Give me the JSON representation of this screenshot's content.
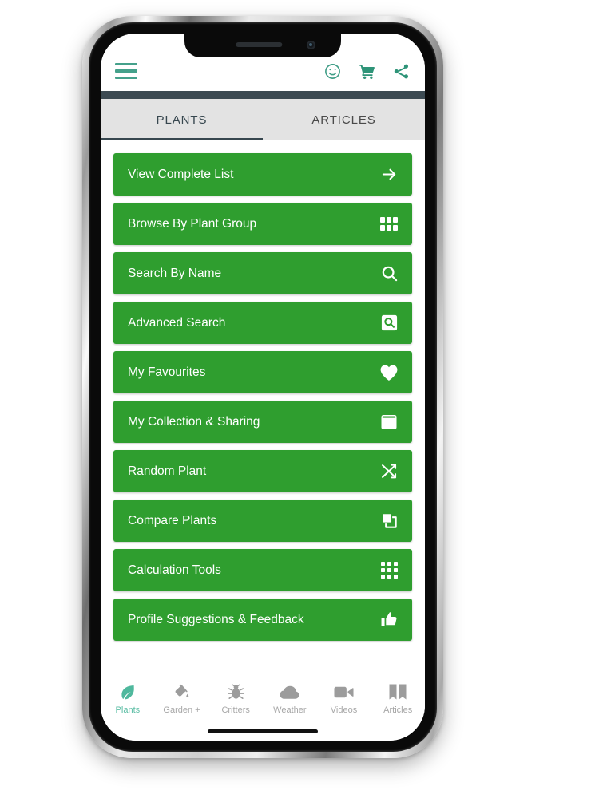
{
  "app": {
    "header": {
      "menu_icon": "hamburger-menu-icon",
      "actions": [
        {
          "name": "smiley-icon",
          "label": "Smiley"
        },
        {
          "name": "cart-icon",
          "label": "Shopping Cart"
        },
        {
          "name": "share-icon",
          "label": "Share"
        }
      ],
      "icon_color": "#45a18b"
    },
    "tabs": [
      {
        "label": "PLANTS",
        "active": true
      },
      {
        "label": "ARTICLES",
        "active": false
      }
    ],
    "menu_items": [
      {
        "label": "View Complete List",
        "icon": "arrow-right-icon"
      },
      {
        "label": "Browse By Plant Group",
        "icon": "grid-2x3-icon"
      },
      {
        "label": "Search By Name",
        "icon": "search-icon"
      },
      {
        "label": "Advanced Search",
        "icon": "search-box-icon"
      },
      {
        "label": "My Favourites",
        "icon": "heart-icon"
      },
      {
        "label": "My Collection & Sharing",
        "icon": "book-icon"
      },
      {
        "label": "Random Plant",
        "icon": "shuffle-icon"
      },
      {
        "label": "Compare Plants",
        "icon": "compare-squares-icon"
      },
      {
        "label": "Calculation Tools",
        "icon": "grid-3x3-dots-icon"
      },
      {
        "label": "Profile Suggestions & Feedback",
        "icon": "thumbs-up-icon"
      }
    ],
    "bottom_nav": [
      {
        "label": "Plants",
        "icon": "leaf-icon",
        "active": true
      },
      {
        "label": "Garden +",
        "icon": "watering-icon",
        "active": false
      },
      {
        "label": "Critters",
        "icon": "bug-icon",
        "active": false
      },
      {
        "label": "Weather",
        "icon": "cloud-icon",
        "active": false
      },
      {
        "label": "Videos",
        "icon": "video-icon",
        "active": false
      },
      {
        "label": "Articles",
        "icon": "book-open-icon",
        "active": false
      }
    ],
    "colors": {
      "button_green": "#2f9e2f",
      "accent_teal": "#45a18b",
      "tab_bar_bg": "#e3e3e3",
      "tab_divider": "#3c4a52",
      "nav_inactive": "#a7a7a7",
      "nav_active": "#5bbda4"
    }
  }
}
